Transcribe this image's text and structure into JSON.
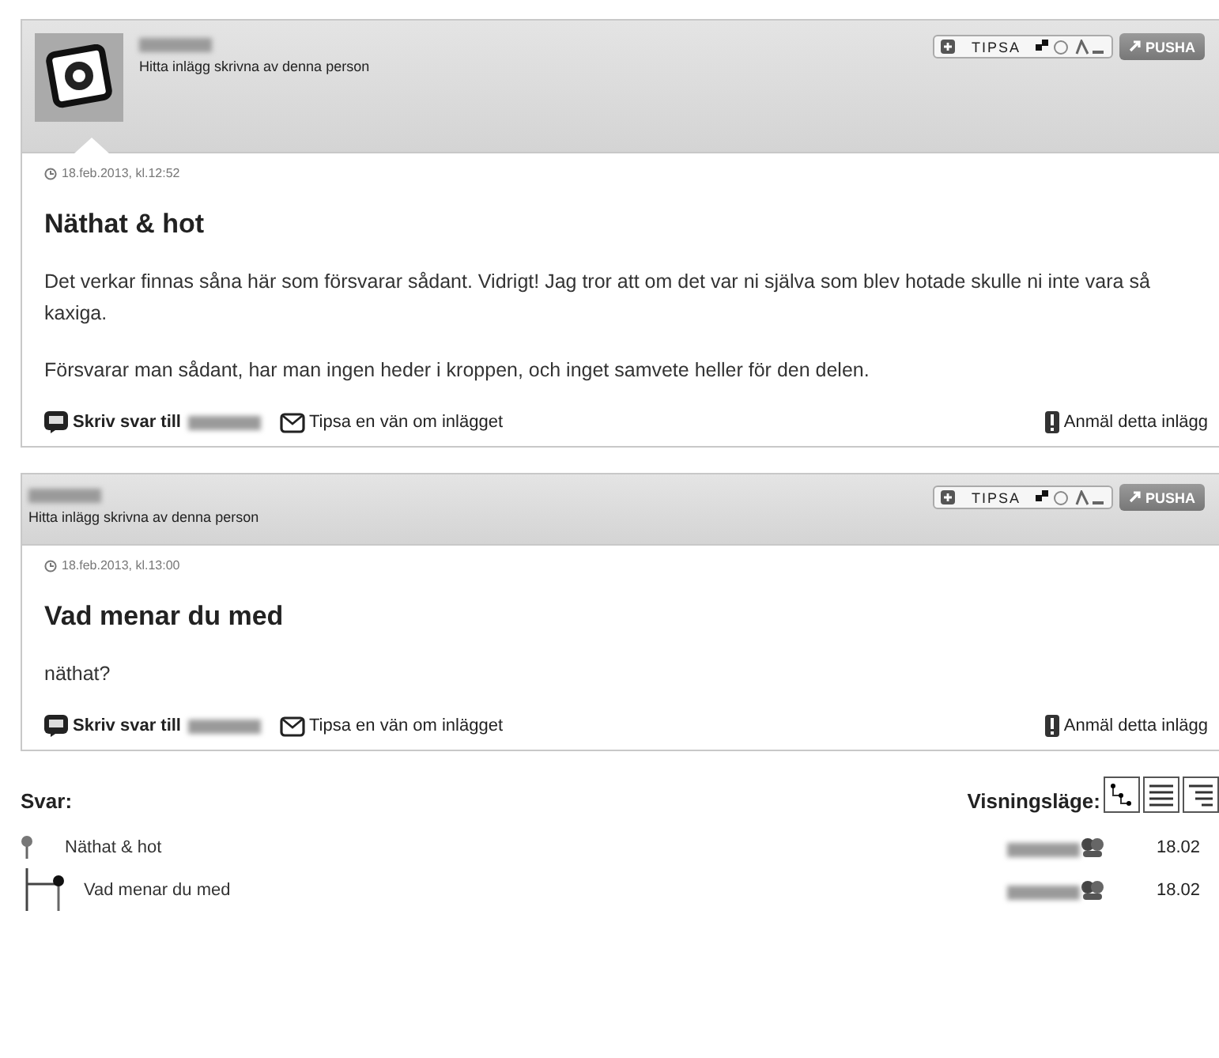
{
  "posts": [
    {
      "has_avatar": true,
      "find_posts": "Hitta inlägg skrivna av denna person",
      "tip_button": "TIPSA",
      "push_button": "PUSHA",
      "date": "18.feb.2013, kl.12:52",
      "title": "Näthat & hot",
      "paragraphs": [
        "Det verkar finnas såna här som försvarar sådant. Vidrigt! Jag tror att om det var ni själva som blev hotade skulle ni inte vara så kaxiga.",
        "Försvarar man sådant, har man ingen heder i kroppen, och inget samvete heller för den delen."
      ],
      "reply": "Skriv svar till",
      "tip_friend": "Tipsa en vän om inlägget",
      "report": "Anmäl detta inlägg"
    },
    {
      "has_avatar": false,
      "find_posts": "Hitta inlägg skrivna av denna person",
      "tip_button": "TIPSA",
      "push_button": "PUSHA",
      "date": "18.feb.2013, kl.13:00",
      "title": "Vad menar du med",
      "paragraphs": [
        "näthat?"
      ],
      "reply": "Skriv svar till",
      "tip_friend": "Tipsa en vän om inlägget",
      "report": "Anmäl detta inlägg"
    }
  ],
  "replies": {
    "heading": "Svar:",
    "view_label": "Visningsläge:",
    "tree": [
      {
        "title": "Näthat & hot",
        "date": "18.02",
        "children": [
          {
            "title": "Vad menar du med",
            "date": "18.02"
          }
        ]
      }
    ]
  }
}
